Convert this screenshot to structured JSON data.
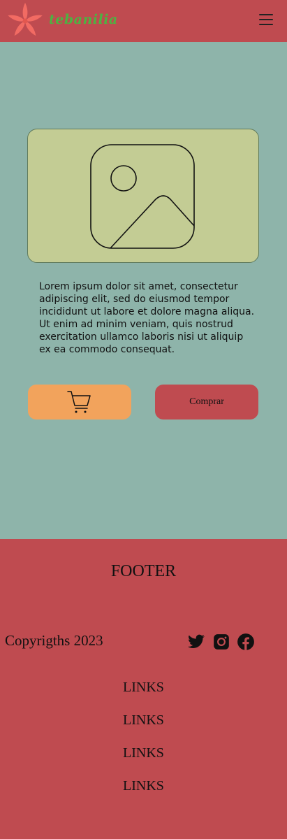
{
  "header": {
    "brand": "tebanilia",
    "menu_icon": "hamburger-menu-icon"
  },
  "product": {
    "image_icon": "image-placeholder-icon",
    "description": "Lorem ipsum dolor sit amet, consectetur adipiscing elit, sed do eiusmod tempor incididunt ut labore et dolore magna aliqua. Ut enim ad minim veniam, quis nostrud exercitation ullamco laboris nisi ut aliquip ex ea commodo consequat.",
    "cart_icon": "shopping-cart-icon",
    "buy_label": "Comprar"
  },
  "footer": {
    "title": "FOOTER",
    "copyright": "Copyrigths 2023",
    "social_icons": [
      "twitter-icon",
      "instagram-icon",
      "facebook-icon"
    ],
    "links": [
      "LINKS",
      "LINKS",
      "LINKS",
      "LINKS"
    ]
  },
  "colors": {
    "header_bg": "#bf4b50",
    "main_bg": "#8eb4aa",
    "card_bg": "#c3cc94",
    "cart_button": "#f2a35c",
    "buy_button": "#bf4b50",
    "brand_text": "#4db242",
    "flower": "#f26b63"
  }
}
